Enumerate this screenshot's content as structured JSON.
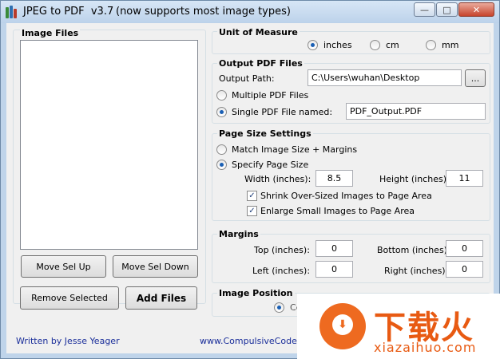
{
  "window": {
    "title": "JPEG to PDF  v3.7",
    "subtitle": "(now supports most image types)",
    "minimize_glyph": "—",
    "maximize_glyph": "□",
    "close_glyph": "✕"
  },
  "image_files": {
    "title": "Image Files",
    "move_up_label": "Move Sel Up",
    "move_down_label": "Move Sel Down",
    "remove_label": "Remove Selected",
    "add_label": "Add Files"
  },
  "unit": {
    "title": "Unit of Measure",
    "options": [
      "inches",
      "cm",
      "mm"
    ],
    "selected": "inches"
  },
  "output": {
    "title": "Output PDF Files",
    "path_label": "Output Path:",
    "path_value": "C:\\Users\\wuhan\\Desktop",
    "browse_label": "...",
    "multiple_label": "Multiple PDF Files",
    "single_label": "Single PDF File named:",
    "single_value": "PDF_Output.PDF",
    "selected": "single"
  },
  "page_size": {
    "title": "Page Size Settings",
    "match_label": "Match Image Size + Margins",
    "specify_label": "Specify Page Size",
    "selected": "specify",
    "width_label": "Width (inches):",
    "width_value": "8.5",
    "height_label": "Height (inches):",
    "height_value": "11",
    "shrink_label": "Shrink Over-Sized Images to Page Area",
    "shrink_checked": true,
    "enlarge_label": "Enlarge Small Images to Page Area",
    "enlarge_checked": true,
    "check_glyph": "✓"
  },
  "margins": {
    "title": "Margins",
    "top_label": "Top (inches):",
    "top_value": "0",
    "bottom_label": "Bottom (inches):",
    "bottom_value": "0",
    "left_label": "Left (inches):",
    "left_value": "0",
    "right_label": "Right (inches):",
    "right_value": "0"
  },
  "image_position": {
    "title": "Image Position",
    "option_label": "Centered"
  },
  "footer": {
    "author": "Written by Jesse Yeager",
    "website": "www.CompulsiveCode."
  },
  "watermark": {
    "text": "下载火",
    "url": "xiazaihuo.com",
    "icon": "download-icon",
    "icon_glyph": "⬇"
  },
  "colors": {
    "titlebar": "#bcd2ea",
    "client": "#f0f0f0",
    "link": "#1a2e9a",
    "watermark": "#e85a12"
  }
}
